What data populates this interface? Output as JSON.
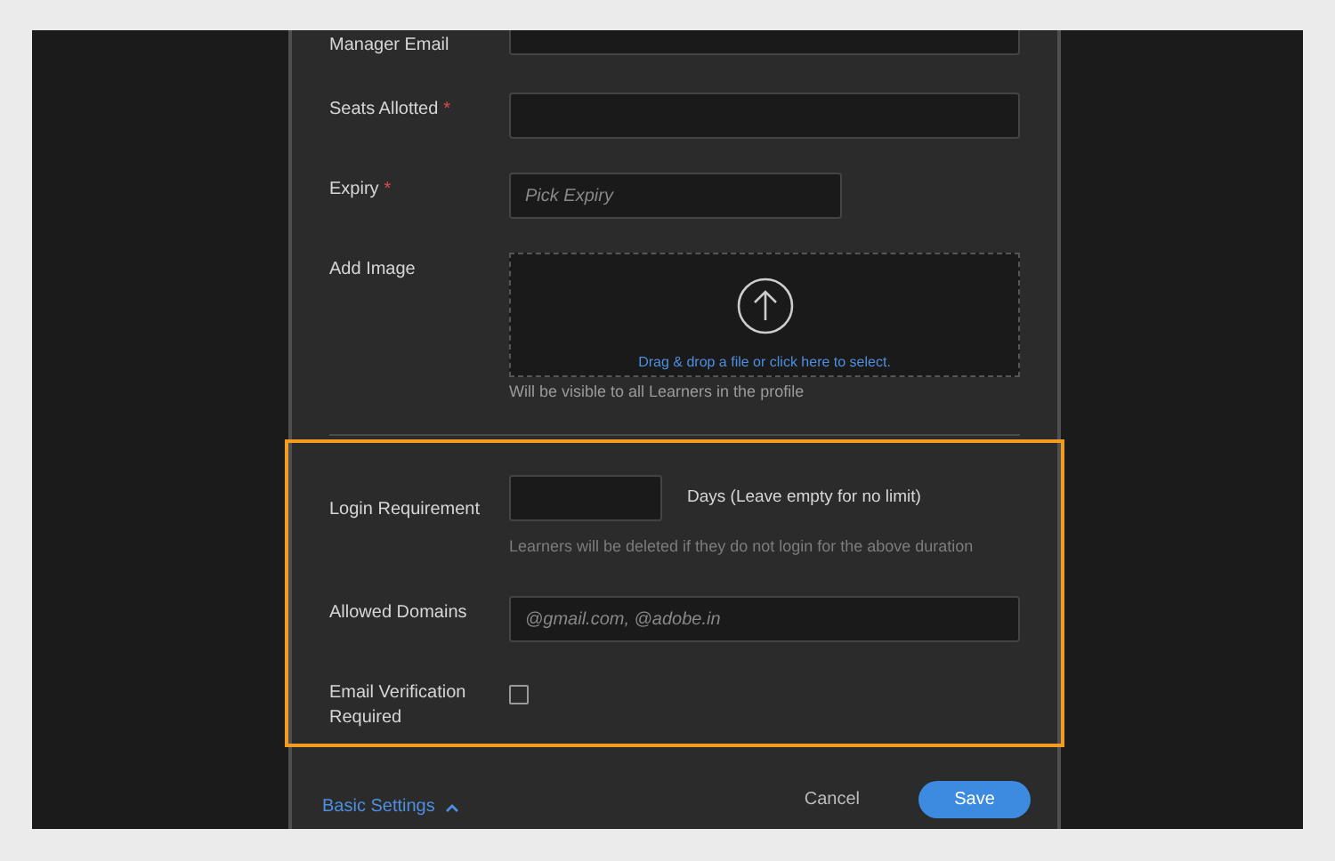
{
  "fields": [
    {
      "kind": "input",
      "label": "Manager Email"
    },
    {
      "kind": "input",
      "label": "Seats Allotted",
      "required_mark": "*"
    },
    {
      "kind": "short-input",
      "label": "Expiry",
      "required_mark": "*",
      "placeholder": "Pick Expiry"
    },
    {
      "kind": "upload",
      "label": "Add Image",
      "prompt": "Drag & drop a file or click here to select.",
      "hint": "Will be visible to all Learners in the profile"
    }
  ],
  "advanced": {
    "highlighted": true,
    "fields": [
      {
        "kind": "days",
        "label": "Login Requirement",
        "suffix": "Days (Leave empty for no limit)",
        "hint": "Learners will be deleted if they do not login for the above duration"
      },
      {
        "kind": "input",
        "label": "Allowed Domains",
        "placeholder": "@gmail.com, @adobe.in"
      },
      {
        "kind": "checkbox",
        "label": "Email Verification Required",
        "checked": false
      }
    ]
  },
  "footer": {
    "toggle": "Basic Settings",
    "expanded": true,
    "cancel": "Cancel",
    "save": "Save"
  }
}
